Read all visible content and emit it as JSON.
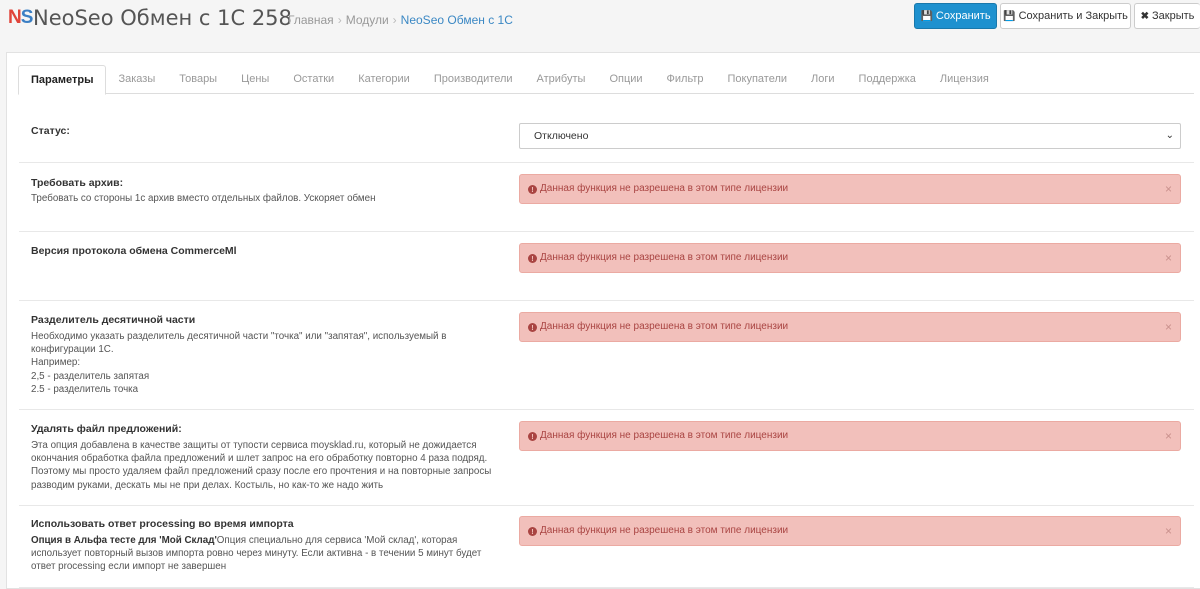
{
  "header": {
    "logo_n": "N",
    "logo_s": "S",
    "title": "NeoSeo Обмен с 1С 258",
    "breadcrumb": [
      "Главная",
      "Модули",
      "NeoSeo Обмен с 1С"
    ],
    "breadcrumb_sep": "›",
    "buttons": {
      "save": "Сохранить",
      "save_close": "Сохранить и Закрыть",
      "close": "Закрыть"
    }
  },
  "tabs": [
    "Параметры",
    "Заказы",
    "Товары",
    "Цены",
    "Остатки",
    "Категории",
    "Производители",
    "Атрибуты",
    "Опции",
    "Фильтр",
    "Покупатели",
    "Логи",
    "Поддержка",
    "Лицензия"
  ],
  "active_tab": "Параметры",
  "fields": {
    "status": {
      "label": "Статус:",
      "value": "Отключено"
    },
    "archive": {
      "label": "Требовать архив:",
      "desc": "Требовать со стороны 1с архив вместо отдельных файлов. Ускоряет обмен"
    },
    "protocol": {
      "label": "Версия протокола обмена CommerceMl"
    },
    "decimal": {
      "label": "Разделитель десятичной части",
      "desc1": "Необходимо указать разделитель десятичной части \"точка\" или \"запятая\", испoльзуемый в конфигурации 1С.",
      "desc2": "Например:",
      "desc3": "2,5 - разделитель запятая",
      "desc4": "2.5 - разделитель точка"
    },
    "offers": {
      "label": "Удалять файл предложений:",
      "desc": "Эта опция добавлена в качестве защиты от тупости сервиса moysklad.ru, который не дожидается окончания обработка файла предложений и шлет запрос на его обработку повторно 4 раза подряд. Поэтому мы просто удаляем файл предложений сразу после его прочтения и на повторные запросы разводим руками, дескать мы не при делах. Костыль, но как-то же надо жить"
    },
    "processing": {
      "label": "Использовать ответ processing во время импорта",
      "desc_bold": "Опция в Альфа тесте для 'Мой Склад'",
      "desc": "Опция специально для сервиса 'Мой склад', которая использует повторный вызов импорта ровно через минуту. Если активна - в течении 5 минут будет ответ processing если импорт не завершен"
    }
  },
  "alert_text": "Данная функция не разрешена в этом типе лицензии",
  "alert_close": "×",
  "colors": {
    "primary": "#1e91cf",
    "alert_bg": "#f2c0bb",
    "alert_text": "#a94442",
    "logo_n": "#e0443a",
    "logo_s": "#3b7fc4"
  }
}
